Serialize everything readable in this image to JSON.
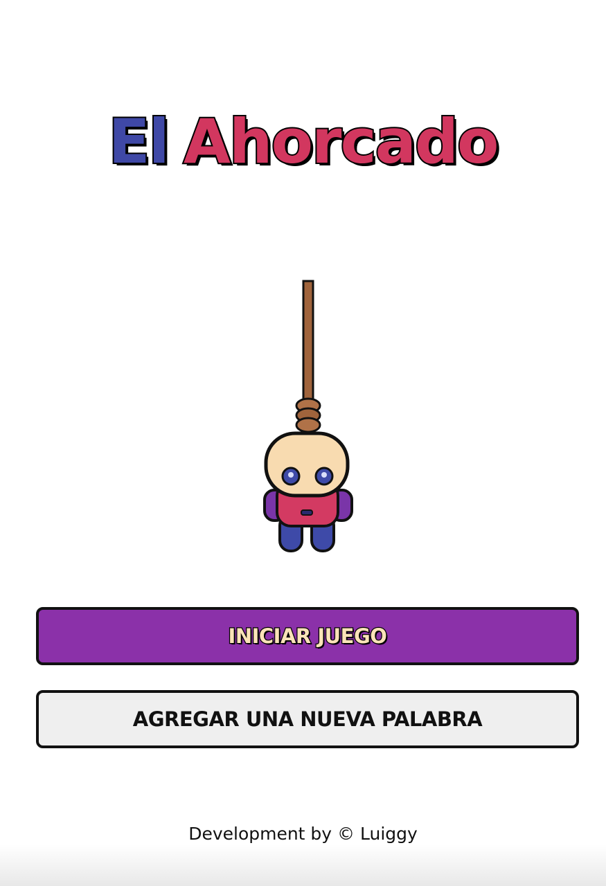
{
  "title": {
    "word1": "El",
    "word2": "Ahorcado"
  },
  "illustration": {
    "icon": "hanging-figure-icon"
  },
  "buttons": {
    "start_label": "INICIAR JUEGO",
    "add_word_label": "AGREGAR UNA NUEVA PALABRA"
  },
  "footer": {
    "credit": "Development by © Luiggy"
  },
  "colors": {
    "title_word1": "#3f48a6",
    "title_word2": "#d2375f",
    "start_button_bg": "#8b31a9",
    "start_button_text": "#fbe3b8",
    "add_button_bg": "#efefef"
  }
}
